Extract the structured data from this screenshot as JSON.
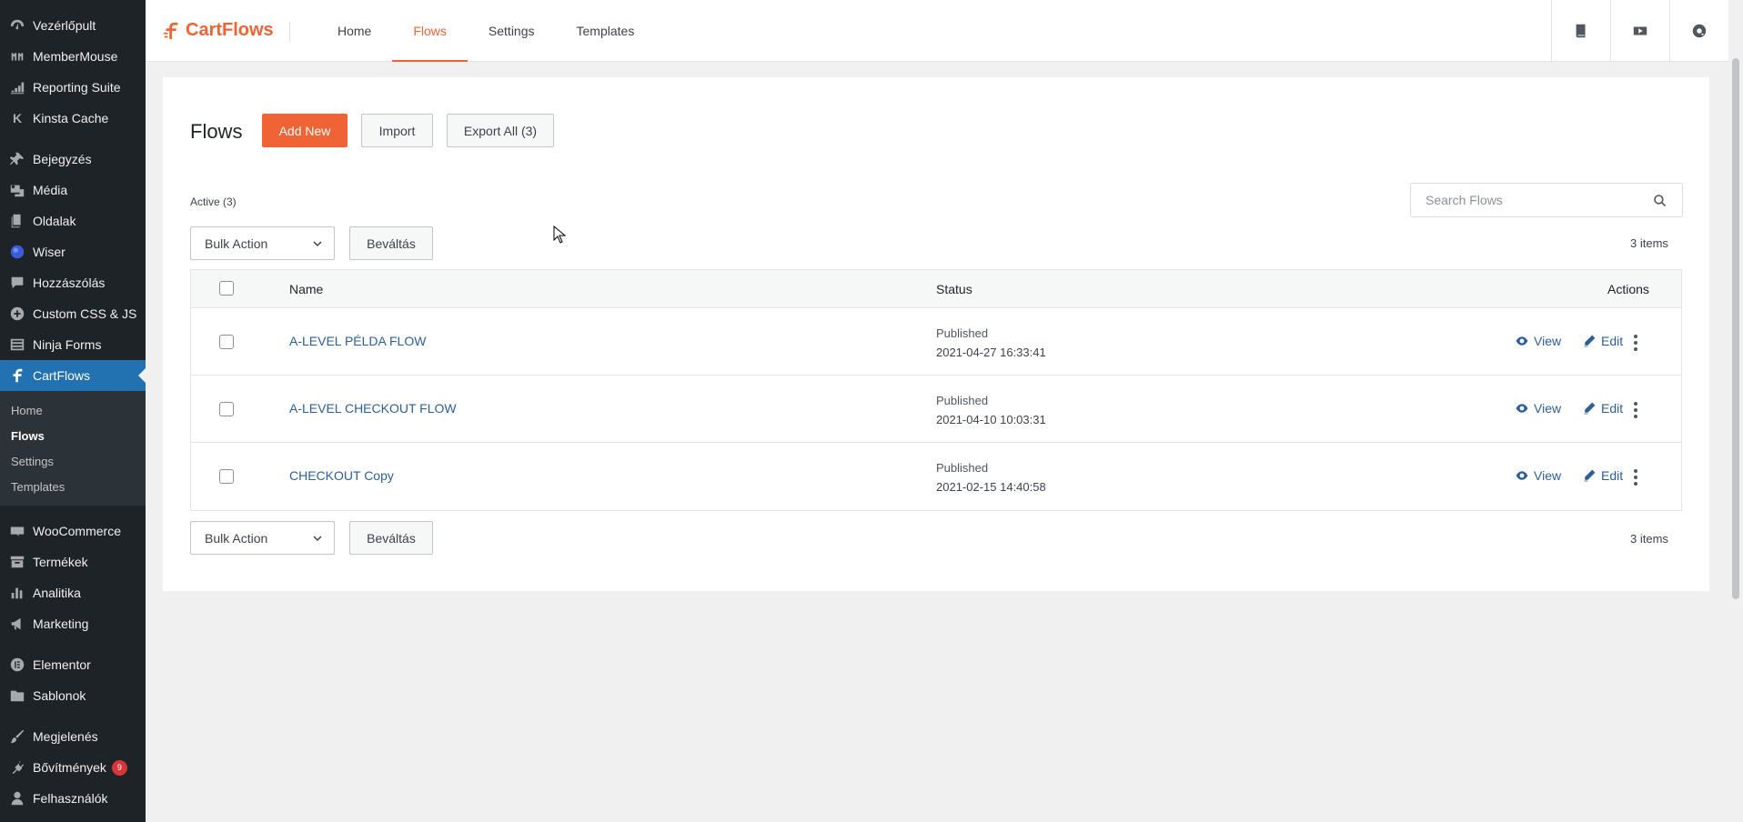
{
  "sidebar": {
    "items": [
      {
        "label": "Vezérlőpult",
        "icon": "dashboard-icon"
      },
      {
        "label": "MemberMouse",
        "icon": "membermouse-icon"
      },
      {
        "label": "Reporting Suite",
        "icon": "chart-icon"
      },
      {
        "label": "Kinsta Cache",
        "icon": "kinsta-icon"
      },
      {
        "label": "Bejegyzés",
        "icon": "pin-icon"
      },
      {
        "label": "Média",
        "icon": "media-icon"
      },
      {
        "label": "Oldalak",
        "icon": "pages-icon"
      },
      {
        "label": "Wiser",
        "icon": "wiser-icon"
      },
      {
        "label": "Hozzászólás",
        "icon": "comments-icon"
      },
      {
        "label": "Custom CSS & JS",
        "icon": "plus-circle-icon"
      },
      {
        "label": "Ninja Forms",
        "icon": "forms-icon"
      },
      {
        "label": "CartFlows",
        "icon": "cartflows-icon"
      },
      {
        "label": "WooCommerce",
        "icon": "woo-icon"
      },
      {
        "label": "Termékek",
        "icon": "archive-icon"
      },
      {
        "label": "Analitika",
        "icon": "bar-chart-icon"
      },
      {
        "label": "Marketing",
        "icon": "megaphone-icon"
      },
      {
        "label": "Elementor",
        "icon": "elementor-icon"
      },
      {
        "label": "Sablonok",
        "icon": "folder-icon"
      },
      {
        "label": "Megjelenés",
        "icon": "brush-icon"
      },
      {
        "label": "Bővítmények",
        "icon": "plugin-icon",
        "badge": "9"
      },
      {
        "label": "Felhasználók",
        "icon": "users-icon"
      }
    ],
    "submenu": [
      "Home",
      "Flows",
      "Settings",
      "Templates"
    ]
  },
  "topbar": {
    "brand": "CartFlows",
    "tabs": [
      "Home",
      "Flows",
      "Settings",
      "Templates"
    ],
    "active_tab": "Flows"
  },
  "page": {
    "title": "Flows",
    "add_new": "Add New",
    "import": "Import",
    "export_all": "Export All (3)",
    "active_filter": "Active (3)",
    "search_placeholder": "Search Flows",
    "bulk_action": "Bulk Action",
    "apply": "Beváltás",
    "items_count": "3 items"
  },
  "table": {
    "headers": {
      "name": "Name",
      "status": "Status",
      "actions": "Actions"
    },
    "rows": [
      {
        "name": "A-LEVEL PÉLDA FLOW",
        "status": "Published",
        "date": "2021-04-27 16:33:41"
      },
      {
        "name": "A-LEVEL CHECKOUT FLOW",
        "status": "Published",
        "date": "2021-04-10 10:03:31"
      },
      {
        "name": "CHECKOUT Copy",
        "status": "Published",
        "date": "2021-02-15 14:40:58"
      }
    ],
    "view_label": "View",
    "edit_label": "Edit"
  },
  "colors": {
    "accent": "#f06335",
    "sidebar": "#1d2327",
    "active_menu": "#2271b1",
    "link": "#2c5f9a"
  }
}
